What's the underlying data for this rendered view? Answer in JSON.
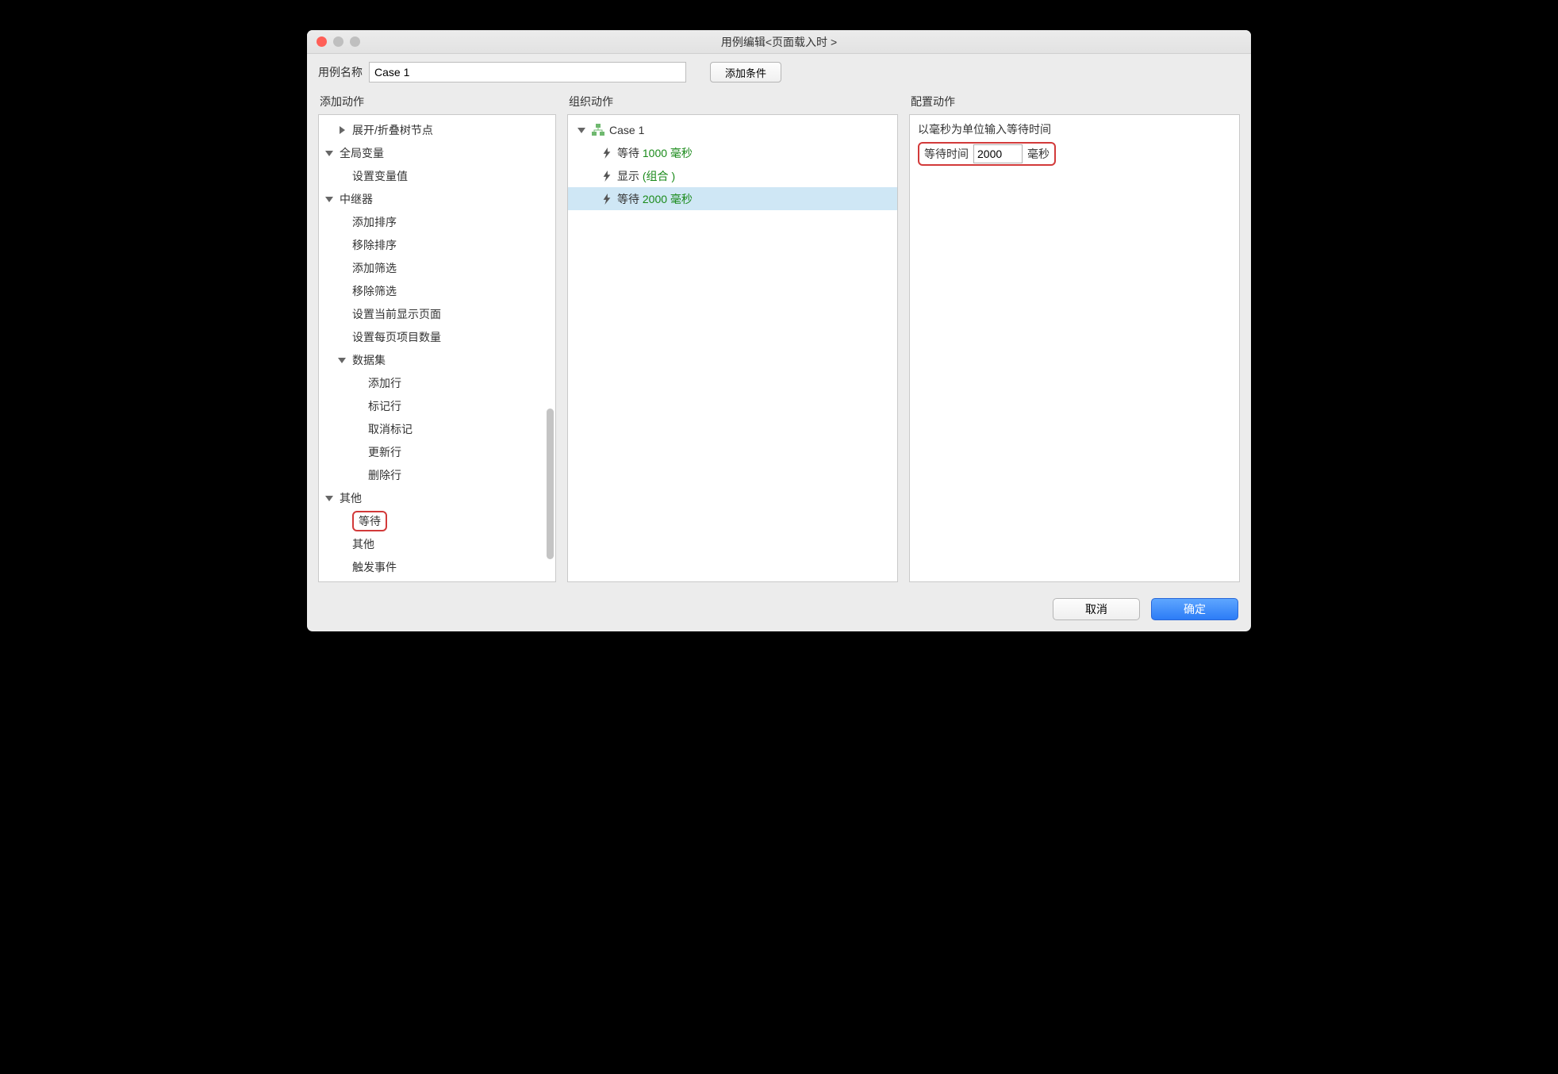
{
  "window": {
    "title": "用例编辑<页面载入时 >"
  },
  "toolbar": {
    "case_label": "用例名称",
    "case_value": "Case 1",
    "add_condition": "添加条件"
  },
  "headers": {
    "add_action": "添加动作",
    "organize": "组织动作",
    "config": "配置动作"
  },
  "actions_tree": {
    "expand_collapse": "展开/折叠树节点",
    "global_var": "全局变量",
    "set_var": "设置变量值",
    "repeater": "中继器",
    "add_sort": "添加排序",
    "remove_sort": "移除排序",
    "add_filter": "添加筛选",
    "remove_filter": "移除筛选",
    "set_current_page": "设置当前显示页面",
    "set_items_per_page": "设置每页项目数量",
    "dataset": "数据集",
    "add_row": "添加行",
    "mark_row": "标记行",
    "unmark_row": "取消标记",
    "update_row": "更新行",
    "delete_row": "删除行",
    "other": "其他",
    "wait": "等待",
    "other_item": "其他",
    "fire_event": "触发事件"
  },
  "organize": {
    "case": "Case 1",
    "wait1_a": "等待 ",
    "wait1_b": "1000 毫秒",
    "show_a": "显示 ",
    "show_b": "(组合 )",
    "wait2_a": "等待 ",
    "wait2_b": "2000 毫秒"
  },
  "config": {
    "prompt": "以毫秒为单位输入等待时间",
    "label": "等待时间",
    "value": "2000",
    "unit": "毫秒"
  },
  "footer": {
    "cancel": "取消",
    "ok": "确定"
  }
}
